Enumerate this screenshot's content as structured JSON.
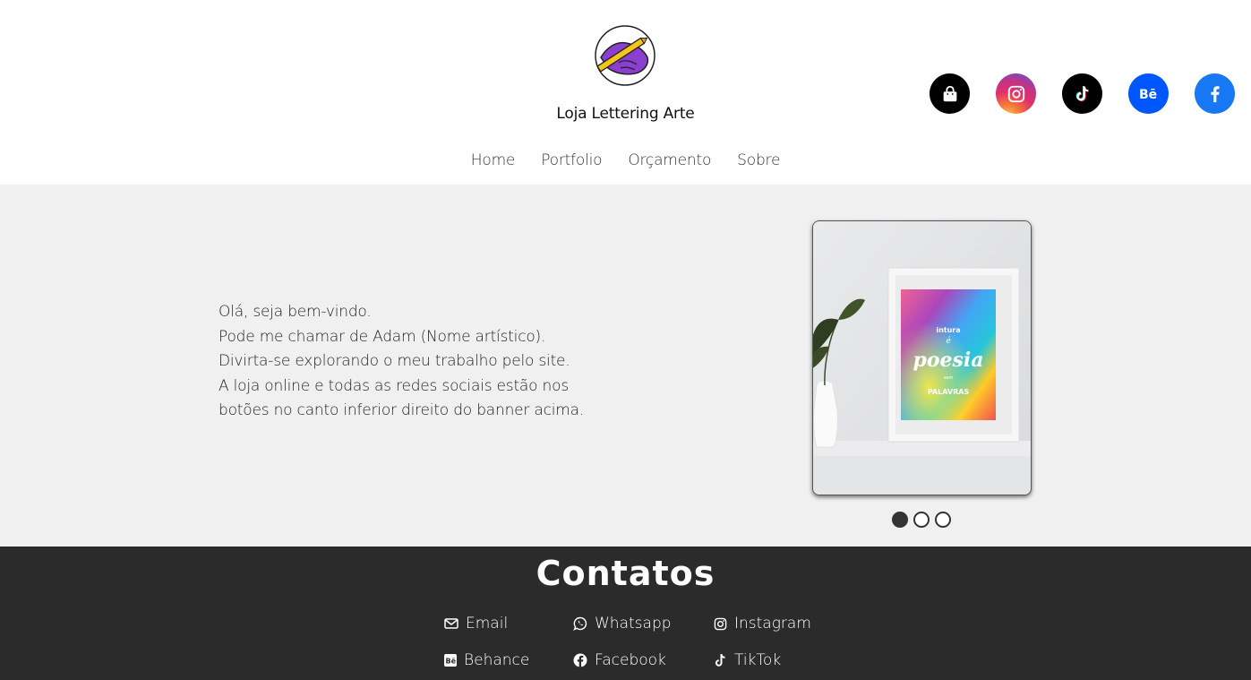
{
  "brand": {
    "name": "Loja Lettering Arte",
    "logo_icon": "hand-with-pencil-logo"
  },
  "nav": {
    "items": [
      "Home",
      "Portfolio",
      "Orçamento",
      "Sobre"
    ]
  },
  "social": [
    {
      "name": "shop",
      "icon": "shopping-bag-icon",
      "color": "#000000"
    },
    {
      "name": "instagram",
      "icon": "instagram-icon",
      "color": "#c13584"
    },
    {
      "name": "tiktok",
      "icon": "tiktok-icon",
      "color": "#000000"
    },
    {
      "name": "behance",
      "icon": "behance-icon",
      "color": "#0057ff"
    },
    {
      "name": "facebook",
      "icon": "facebook-icon",
      "color": "#1877f2"
    }
  ],
  "intro": {
    "lines": [
      "Olá, seja bem-vindo.",
      "Pode me chamar de Adam (Nome artístico).",
      "Divirta-se explorando o meu trabalho pelo site.",
      "A loja online e todas as redes sociais estão nos",
      "botões no canto inferior direito do banner acima."
    ]
  },
  "carousel": {
    "poster_text": {
      "top": "intura",
      "middle": "é",
      "main": "poesia",
      "sub": "sem",
      "bottom": "PALAVRAS"
    },
    "slide_count": 3,
    "active_slide": 1
  },
  "footer": {
    "title": "Contatos",
    "contacts": [
      {
        "label": "Email",
        "icon": "envelope-icon"
      },
      {
        "label": "Whatsapp",
        "icon": "whatsapp-icon"
      },
      {
        "label": "Instagram",
        "icon": "instagram-icon"
      },
      {
        "label": "Behance",
        "icon": "behance-icon"
      },
      {
        "label": "Facebook",
        "icon": "facebook-icon"
      },
      {
        "label": "TikTok",
        "icon": "tiktok-icon"
      }
    ]
  }
}
